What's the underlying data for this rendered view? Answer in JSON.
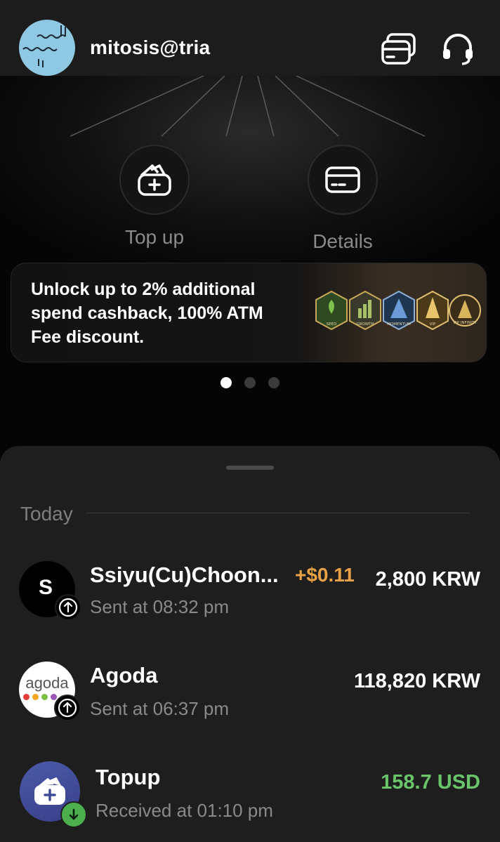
{
  "header": {
    "username": "mitosis@tria",
    "icons": [
      "avatar-scribble",
      "cards-icon",
      "headset-icon"
    ]
  },
  "actions": [
    {
      "label": "Top up",
      "icon": "wallet-add-icon"
    },
    {
      "label": "Details",
      "icon": "card-icon"
    }
  ],
  "promo": {
    "text": "Unlock up to 2% additional spend cashback, 100% ATM Fee discount.",
    "badges": [
      "SEED",
      "GROWTH",
      "MOMENTUM",
      "VIP",
      "VIP INFINITY"
    ]
  },
  "carousel": {
    "count": 3,
    "active_index": 0
  },
  "activity": {
    "section": "Today",
    "transactions": [
      {
        "name": "Ssiyu(Cu)Choon...",
        "avatar_letter": "S",
        "status": "Sent at 08:32 pm",
        "reward": "+$0.11",
        "amount": "2,800 KRW",
        "direction": "sent"
      },
      {
        "name": "Agoda",
        "avatar_text": "agoda",
        "status": "Sent at 06:37 pm",
        "amount": "118,820 KRW",
        "direction": "sent"
      },
      {
        "name": "Topup",
        "status": "Received at 01:10 pm",
        "amount": "158.7 USD",
        "direction": "received"
      }
    ]
  },
  "colors": {
    "background": "#050505",
    "sheet": "#1e1e1e",
    "reward": "#e8a146",
    "received_amount": "#6ac46a",
    "avatar_blue": "#8ec8e2"
  }
}
